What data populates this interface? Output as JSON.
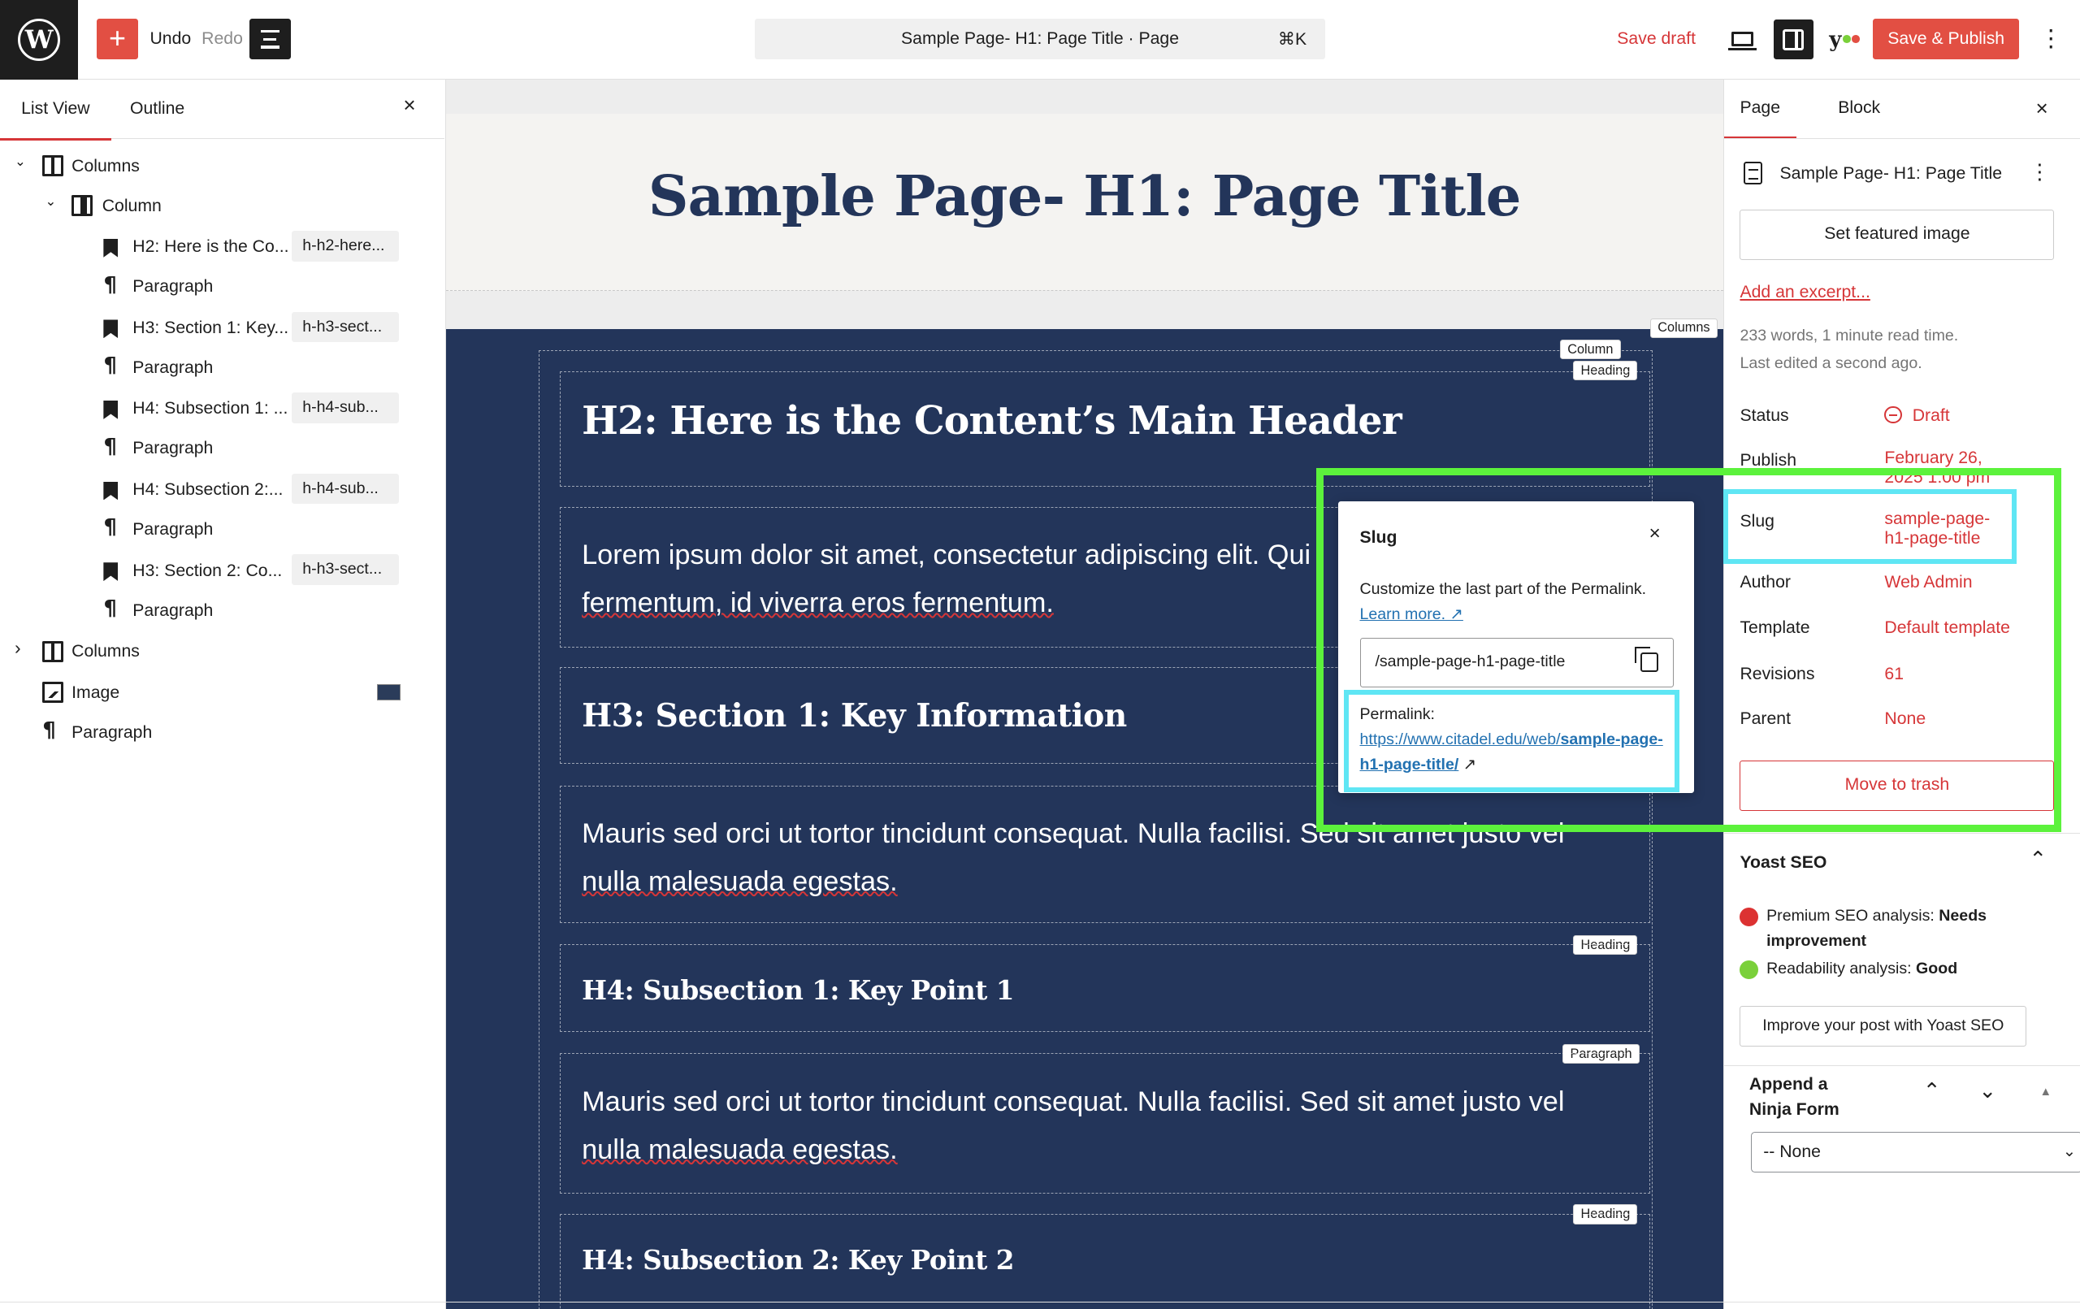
{
  "topbar": {
    "undo": "Undo",
    "redo": "Redo",
    "command_bar": "Sample Page- H1: Page Title · Page",
    "shortcut": "⌘K",
    "save_draft": "Save draft",
    "publish": "Save & Publish",
    "add_symbol": "+",
    "more_symbol": "⋮"
  },
  "left_panel": {
    "tabs": [
      "List View",
      "Outline"
    ],
    "close": "×",
    "tree": [
      {
        "label": "Columns",
        "type": "columns",
        "level": 0,
        "expanded": true,
        "anchor": ""
      },
      {
        "label": "Column",
        "type": "column",
        "level": 1,
        "expanded": true,
        "anchor": ""
      },
      {
        "label": "H2: Here is the Co...",
        "type": "heading",
        "level": 2,
        "anchor": "h-h2-here..."
      },
      {
        "label": "Paragraph",
        "type": "paragraph",
        "level": 2,
        "anchor": ""
      },
      {
        "label": "H3: Section 1: Key...",
        "type": "heading",
        "level": 2,
        "anchor": "h-h3-sect..."
      },
      {
        "label": "Paragraph",
        "type": "paragraph",
        "level": 2,
        "anchor": ""
      },
      {
        "label": "H4: Subsection 1: ...",
        "type": "heading",
        "level": 2,
        "anchor": "h-h4-sub..."
      },
      {
        "label": "Paragraph",
        "type": "paragraph",
        "level": 2,
        "anchor": ""
      },
      {
        "label": "H4: Subsection 2:...",
        "type": "heading",
        "level": 2,
        "anchor": "h-h4-sub..."
      },
      {
        "label": "Paragraph",
        "type": "paragraph",
        "level": 2,
        "anchor": ""
      },
      {
        "label": "H3: Section 2: Co...",
        "type": "heading",
        "level": 2,
        "anchor": "h-h3-sect..."
      },
      {
        "label": "Paragraph",
        "type": "paragraph",
        "level": 2,
        "anchor": ""
      },
      {
        "label": "Columns",
        "type": "columns",
        "level": 0,
        "expanded": false,
        "anchor": ""
      },
      {
        "label": "Image",
        "type": "image",
        "level": 0,
        "anchor": ""
      },
      {
        "label": "Paragraph",
        "type": "paragraph",
        "level": 0,
        "anchor": ""
      }
    ]
  },
  "canvas": {
    "page_title": "Sample Page- H1: Page Title",
    "badges": {
      "columns": "Columns",
      "column": "Column",
      "heading": "Heading",
      "paragraph": "Paragraph"
    },
    "h2": "H2: Here is the Content’s Main Header",
    "p1": "Lorem ipsum dolor sit amet, consectetur adipiscing elit. Quis fermentum, id viverra eros fermentum.",
    "p1_line1": "Lorem ipsum dolor sit amet, consectetur adipiscing elit. Qui",
    "p1_line2": "fermentum, id viverra eros fermentum.",
    "h3_1": "H3: Section 1: Key Information",
    "p2_line1": "Mauris sed orci ut tortor tincidunt consequat. Nulla facilisi.",
    "p2_line1b": "Sed sit amet justo vel",
    "p2_line2": "nulla malesuada egestas.",
    "h4_1": "H4: Subsection 1: Key Point 1",
    "p3_line1": "Mauris sed orci ut tortor tincidunt consequat. Nulla facilisi. Sed sit amet justo vel",
    "p3_line2": "nulla malesuada egestas.",
    "h4_2": "H4: Subsection 2: Key Point 2"
  },
  "slug_popover": {
    "title": "Slug",
    "close": "×",
    "description": "Customize the last part of the Permalink.",
    "learn_more": "Learn more. ↗",
    "input_value": "/sample-page-h1-page-title",
    "permalink_label": "Permalink:",
    "permalink_base": "https://www.citadel.edu/web/",
    "permalink_slug": "sample-page-h1-page-title/",
    "external_arrow": "↗"
  },
  "right_panel": {
    "tabs": [
      "Page",
      "Block"
    ],
    "close": "×",
    "doc_title": "Sample Page- H1: Page Title",
    "featured_image": "Set featured image",
    "add_excerpt": "Add an excerpt...",
    "words": "233 words, 1 minute read time.",
    "last_edited": "Last edited a second ago.",
    "properties": [
      {
        "label": "Status",
        "value": "Draft"
      },
      {
        "label": "Publish",
        "value": "February 26, 2025 1:00 pm"
      },
      {
        "label": "Slug",
        "value": "sample-page-h1-page-title"
      },
      {
        "label": "Author",
        "value": "Web Admin"
      },
      {
        "label": "Template",
        "value": "Default template"
      },
      {
        "label": "Revisions",
        "value": "61"
      },
      {
        "label": "Parent",
        "value": "None"
      }
    ],
    "slug_value_line1": "sample-page-",
    "slug_value_line2": "h1-page-title",
    "publish_line1": "February 26,",
    "publish_line2": "2025 1:00 pm",
    "move_to_trash": "Move to trash",
    "yoast": {
      "title": "Yoast SEO",
      "seo_label": "Premium SEO analysis:",
      "seo_value": "Needs improvement",
      "read_label": "Readability analysis:",
      "read_value": "Good",
      "improve": "Improve your post with Yoast SEO"
    },
    "ninja": {
      "title": "Append a Ninja Form",
      "select_value": "-- None"
    }
  },
  "colors": {
    "accent": "#d63638",
    "publish_button": "#e24f43",
    "section_bg": "#23355a",
    "highlight_green": "#5cf23c",
    "highlight_cyan": "#5fe6f4"
  }
}
